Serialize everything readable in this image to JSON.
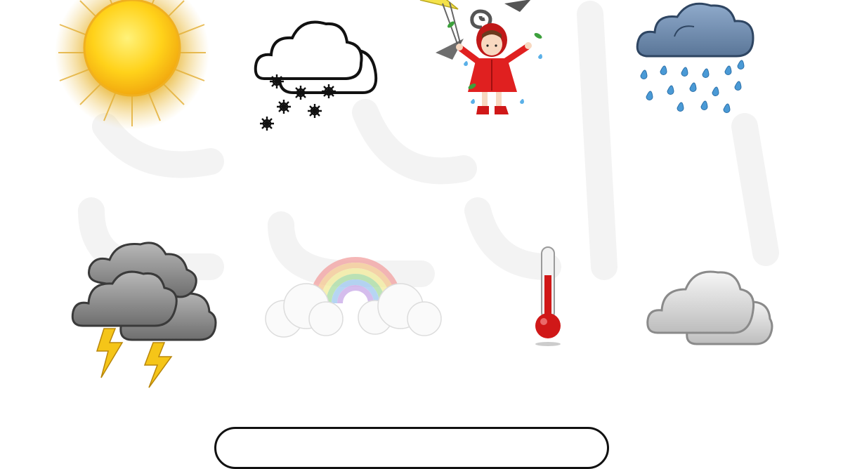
{
  "worksheet": {
    "rows": [
      [
        {
          "id": "sunny",
          "icon": "sun-icon"
        },
        {
          "id": "snowy",
          "icon": "snow-cloud-icon"
        },
        {
          "id": "windy",
          "icon": "windy-girl-icon"
        },
        {
          "id": "rainy",
          "icon": "rain-cloud-icon"
        }
      ],
      [
        {
          "id": "stormy",
          "icon": "thunderstorm-icon"
        },
        {
          "id": "rainbow",
          "icon": "rainbow-icon"
        },
        {
          "id": "hot",
          "icon": "thermometer-icon"
        },
        {
          "id": "cloudy",
          "icon": "cloud-icon"
        }
      ]
    ],
    "answer_box": {
      "text": ""
    }
  },
  "colors": {
    "sun": "#FFD21A",
    "sun_rays": "#E8B82A",
    "rain_cloud": "#6F8FB3",
    "raindrop": "#4A9AD6",
    "storm_cloud": "#8C8C8C",
    "lightning": "#F5C518",
    "thermometer": "#D01818",
    "coat": "#E02020",
    "watermark": "#F4F4F4"
  }
}
